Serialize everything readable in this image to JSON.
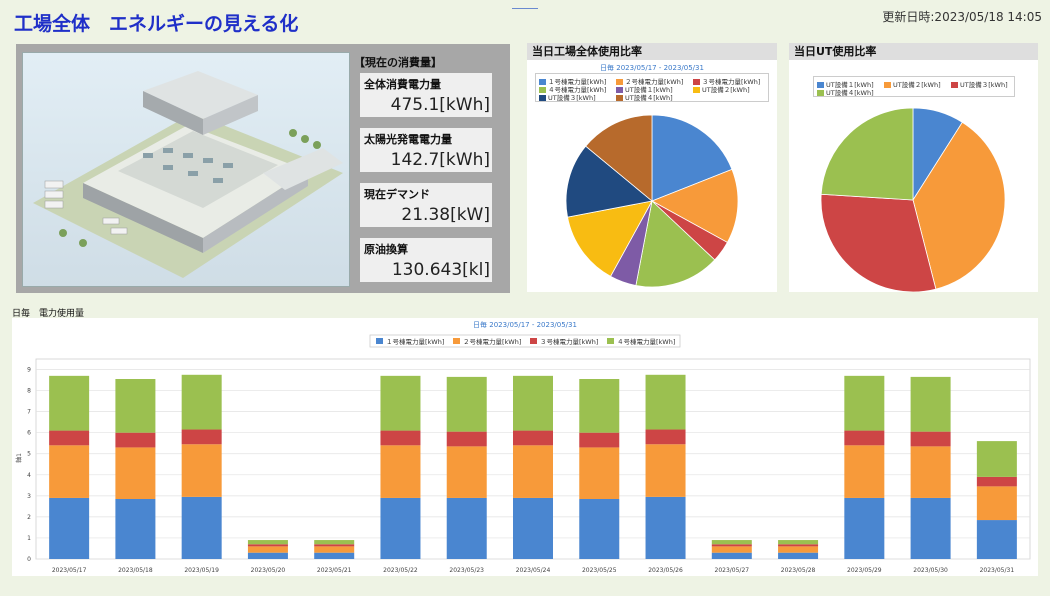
{
  "header": {
    "title": "工場全体　エネルギーの見える化",
    "updated": "更新日時:2023/05/18 14:05"
  },
  "factory": {
    "section_label": "【現在の消費量】",
    "metrics": [
      {
        "label": "全体消費電力量",
        "value": "475.1[kWh]"
      },
      {
        "label": "太陽光発電電力量",
        "value": "142.7[kWh]"
      },
      {
        "label": "現在デマンド",
        "value": "21.38[kW]"
      },
      {
        "label": "原油換算",
        "value": "130.643[kl]"
      }
    ]
  },
  "pie1": {
    "title": "当日工場全体使用比率",
    "subtitle": "日毎 2023/05/17 - 2023/05/31",
    "legend": [
      "１号棟電力量[kWh]",
      "２号棟電力量[kWh]",
      "３号棟電力量[kWh]",
      "４号棟電力量[kWh]",
      "UT設備１[kWh]",
      "UT設備２[kWh]",
      "UT設備３[kWh]",
      "UT設備４[kWh]"
    ]
  },
  "pie2": {
    "title": "当日UT使用比率",
    "legend": [
      "UT設備１[kWh]",
      "UT設備２[kWh]",
      "UT設備３[kWh]",
      "UT設備４[kWh]"
    ]
  },
  "bar": {
    "section_label": "日毎　電力使用量",
    "subtitle": "日毎 2023/05/17 - 2023/05/31",
    "ylabel": "軸1"
  },
  "chart_data": [
    {
      "type": "pie",
      "labels": [
        "１号棟電力量[kWh]",
        "２号棟電力量[kWh]",
        "３号棟電力量[kWh]",
        "４号棟電力量[kWh]",
        "UT設備１[kWh]",
        "UT設備２[kWh]",
        "UT設備３[kWh]",
        "UT設備４[kWh]"
      ],
      "values": [
        19,
        14,
        4,
        16,
        5,
        14,
        14,
        14
      ],
      "colors": [
        "#4a86d0",
        "#f79a3a",
        "#cd4545",
        "#9bc050",
        "#7e5ba6",
        "#f8bc12",
        "#204a80",
        "#b76a2c"
      ]
    },
    {
      "type": "pie",
      "labels": [
        "UT設備１[kWh]",
        "UT設備２[kWh]",
        "UT設備３[kWh]",
        "UT設備４[kWh]"
      ],
      "values": [
        9,
        37,
        30,
        24
      ],
      "colors": [
        "#4a86d0",
        "#f79a3a",
        "#cd4545",
        "#9bc050"
      ]
    },
    {
      "type": "bar",
      "stacked": true,
      "categories": [
        "2023/05/17",
        "2023/05/18",
        "2023/05/19",
        "2023/05/20",
        "2023/05/21",
        "2023/05/22",
        "2023/05/23",
        "2023/05/24",
        "2023/05/25",
        "2023/05/26",
        "2023/05/27",
        "2023/05/28",
        "2023/05/29",
        "2023/05/30",
        "2023/05/31"
      ],
      "series": [
        {
          "name": "１号棟電力量[kWh]",
          "color": "#4a86d0",
          "values": [
            2.9,
            2.85,
            2.95,
            0.3,
            0.3,
            2.9,
            2.9,
            2.9,
            2.85,
            2.95,
            0.3,
            0.3,
            2.9,
            2.9,
            1.85
          ]
        },
        {
          "name": "２号棟電力量[kWh]",
          "color": "#f79a3a",
          "values": [
            2.5,
            2.45,
            2.5,
            0.3,
            0.3,
            2.5,
            2.45,
            2.5,
            2.45,
            2.5,
            0.3,
            0.3,
            2.5,
            2.45,
            1.6
          ]
        },
        {
          "name": "３号棟電力量[kWh]",
          "color": "#cd4545",
          "values": [
            0.7,
            0.7,
            0.7,
            0.1,
            0.1,
            0.7,
            0.7,
            0.7,
            0.7,
            0.7,
            0.1,
            0.1,
            0.7,
            0.7,
            0.45
          ]
        },
        {
          "name": "４号棟電力量[kWh]",
          "color": "#9bc050",
          "values": [
            2.6,
            2.55,
            2.6,
            0.2,
            0.2,
            2.6,
            2.6,
            2.6,
            2.55,
            2.6,
            0.2,
            0.2,
            2.6,
            2.6,
            1.7
          ]
        }
      ],
      "yticks": [
        0,
        1,
        2,
        3,
        4,
        5,
        6,
        7,
        8,
        9
      ],
      "ylim": [
        0,
        9.5
      ],
      "grid": true,
      "legend_position": "top-center"
    }
  ]
}
